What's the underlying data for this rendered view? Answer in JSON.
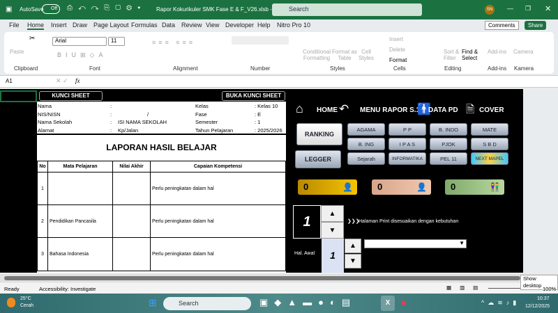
{
  "titlebar": {
    "autosave": "AutoSave",
    "toggle": "Off",
    "doc_title": "Rapor Kokurikuler SMK Fase E & F_V26.xlsb -...",
    "search": "Search",
    "avatar": "SN"
  },
  "menu": [
    "File",
    "Home",
    "Insert",
    "Draw",
    "Page Layout",
    "Formulas",
    "Data",
    "Review",
    "View",
    "Developer",
    "Help",
    "Nitro Pro 10"
  ],
  "menu_right": {
    "comments": "Comments",
    "share": "Share"
  },
  "ribbon": {
    "paste": "Paste",
    "font": "Arial",
    "size": "11",
    "groups": [
      "Clipboard",
      "Font",
      "Alignment",
      "Number",
      "Styles",
      "Cells",
      "Editing",
      "Add-ins",
      "Kamera"
    ],
    "cond": "Conditional Formatting",
    "fmt_table": "Format as Table",
    "cell_styles": "Cell Styles",
    "insert": "Insert",
    "delete": "Delete",
    "format": "Format",
    "sort": "Sort & Filter",
    "find": "Find & Select",
    "addins": "Add-ins",
    "camera": "Camera"
  },
  "formula": {
    "cell": "A1",
    "fx": "fx",
    "value": ""
  },
  "sheet": {
    "kunci": "KUNCI SHEET",
    "buka": "BUKA  KUNCI SHEET",
    "info_left": [
      [
        "Nama",
        ":",
        ""
      ],
      [
        "NIS/NISN",
        ":",
        "/"
      ],
      [
        "Nama Sekolah",
        ":",
        "ISI NAMA SEKOLAH"
      ],
      [
        "Alamat",
        ":",
        "Kp/Jalan"
      ]
    ],
    "info_right": [
      [
        "Kelas",
        ": Kelas 10"
      ],
      [
        "Fase",
        ": E"
      ],
      [
        "Semester",
        ": 1"
      ],
      [
        "Tahun Pelajaran",
        ": 2025/2026"
      ]
    ],
    "report_title": "LAPORAN HASIL BELAJAR",
    "headers": [
      "No",
      "Mata Pelajaran",
      "Nilai Akhir",
      "Capaian Kompetensi"
    ],
    "rows": [
      [
        "1",
        "",
        "",
        "Perlu peningkatan dalam hal"
      ],
      [
        "2",
        "Pendidikan Pancasila",
        "",
        "Perlu peningkatan dalam hal"
      ],
      [
        "3",
        "Bahasa Indonesia",
        "",
        "Perlu peningkatan dalam hal"
      ]
    ]
  },
  "panel": {
    "home": "HOME",
    "menu": "MENU RAPOR S.1",
    "data_pd": "DATA PD",
    "cover": "COVER",
    "ranking": "RANKING",
    "legger": "LEGGER",
    "subjects": [
      "AGAMA",
      "P P",
      "B. INDO",
      "MATE",
      "B. ING",
      "I P A S",
      "PJOK",
      "S B D",
      "Sejarah",
      "INFORMATIKA",
      "PEL 11",
      "NEXT MAPEL"
    ],
    "counts": [
      "0",
      "0",
      "0"
    ],
    "page": "1",
    "hint": "Halaman Print disesuaikan dengan kebutuhan",
    "hal_awal": "Hal. Awal",
    "hal_value": "1"
  },
  "status": {
    "ready": "Ready",
    "accessibility": "Accessibility: Investigate",
    "zoom": "100%",
    "tooltip": "Show desktop"
  },
  "taskbar": {
    "temp": "25°C",
    "weather": "Cerah",
    "search": "Search",
    "time": "10:37",
    "date": "12/12/2025"
  }
}
